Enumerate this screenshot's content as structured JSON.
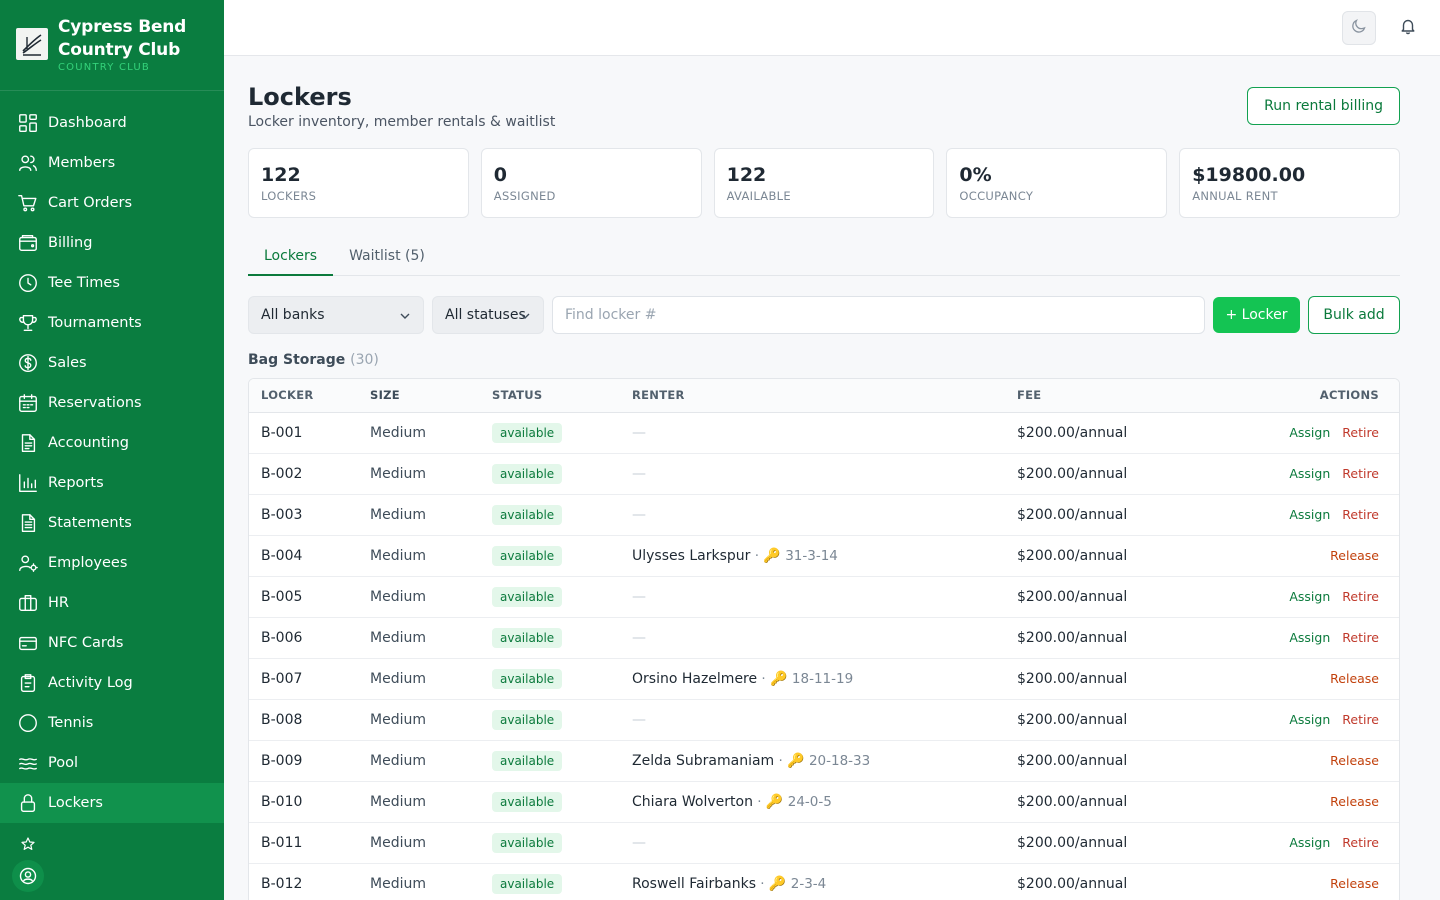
{
  "brand": {
    "name_line1": "Cypress Bend",
    "name_line2": "Country Club",
    "subtitle": "COUNTRY CLUB"
  },
  "sidebar": {
    "items": [
      {
        "label": "Dashboard",
        "icon": "dashboard-icon"
      },
      {
        "label": "Members",
        "icon": "members-icon"
      },
      {
        "label": "Cart Orders",
        "icon": "cart-icon"
      },
      {
        "label": "Billing",
        "icon": "wallet-icon"
      },
      {
        "label": "Tee Times",
        "icon": "clock-icon"
      },
      {
        "label": "Tournaments",
        "icon": "trophy-icon"
      },
      {
        "label": "Sales",
        "icon": "dollar-icon"
      },
      {
        "label": "Reservations",
        "icon": "calendar-icon"
      },
      {
        "label": "Accounting",
        "icon": "document-icon"
      },
      {
        "label": "Reports",
        "icon": "bar-chart-icon"
      },
      {
        "label": "Statements",
        "icon": "statement-icon"
      },
      {
        "label": "Employees",
        "icon": "employee-icon"
      },
      {
        "label": "HR",
        "icon": "briefcase-icon"
      },
      {
        "label": "NFC Cards",
        "icon": "card-icon"
      },
      {
        "label": "Activity Log",
        "icon": "clipboard-icon"
      },
      {
        "label": "Tennis",
        "icon": "tennis-icon"
      },
      {
        "label": "Pool",
        "icon": "waves-icon"
      },
      {
        "label": "Lockers",
        "icon": "lock-icon",
        "active": true
      }
    ]
  },
  "header": {
    "title": "Lockers",
    "subtitle": "Locker inventory, member rentals & waitlist",
    "billing_button": "Run rental billing"
  },
  "stats": [
    {
      "value": "122",
      "label": "LOCKERS"
    },
    {
      "value": "0",
      "label": "ASSIGNED"
    },
    {
      "value": "122",
      "label": "AVAILABLE"
    },
    {
      "value": "0%",
      "label": "OCCUPANCY"
    },
    {
      "value": "$19800.00",
      "label": "ANNUAL RENT"
    }
  ],
  "tabs": [
    {
      "label": "Lockers",
      "active": true
    },
    {
      "label": "Waitlist (5)",
      "active": false
    }
  ],
  "filters": {
    "bank": "All banks",
    "status": "All statuses",
    "search_placeholder": "Find locker #",
    "add_label": "+ Locker",
    "bulk_label": "Bulk add"
  },
  "group": {
    "name": "Bag Storage",
    "count": "(30)"
  },
  "table": {
    "columns": {
      "locker": "LOCKER",
      "size": "SIZE",
      "status": "STATUS",
      "renter": "RENTER",
      "fee": "FEE",
      "actions": "ACTIONS"
    },
    "rows": [
      {
        "locker": "B-001",
        "size": "Medium",
        "status": "available",
        "renter": "",
        "code": "",
        "fee": "$200.00/annual",
        "actions": [
          "Assign",
          "Retire"
        ]
      },
      {
        "locker": "B-002",
        "size": "Medium",
        "status": "available",
        "renter": "",
        "code": "",
        "fee": "$200.00/annual",
        "actions": [
          "Assign",
          "Retire"
        ]
      },
      {
        "locker": "B-003",
        "size": "Medium",
        "status": "available",
        "renter": "",
        "code": "",
        "fee": "$200.00/annual",
        "actions": [
          "Assign",
          "Retire"
        ]
      },
      {
        "locker": "B-004",
        "size": "Medium",
        "status": "available",
        "renter": "Ulysses Larkspur",
        "code": "31-3-14",
        "fee": "$200.00/annual",
        "actions": [
          "Release"
        ]
      },
      {
        "locker": "B-005",
        "size": "Medium",
        "status": "available",
        "renter": "",
        "code": "",
        "fee": "$200.00/annual",
        "actions": [
          "Assign",
          "Retire"
        ]
      },
      {
        "locker": "B-006",
        "size": "Medium",
        "status": "available",
        "renter": "",
        "code": "",
        "fee": "$200.00/annual",
        "actions": [
          "Assign",
          "Retire"
        ]
      },
      {
        "locker": "B-007",
        "size": "Medium",
        "status": "available",
        "renter": "Orsino Hazelmere",
        "code": "18-11-19",
        "fee": "$200.00/annual",
        "actions": [
          "Release"
        ]
      },
      {
        "locker": "B-008",
        "size": "Medium",
        "status": "available",
        "renter": "",
        "code": "",
        "fee": "$200.00/annual",
        "actions": [
          "Assign",
          "Retire"
        ]
      },
      {
        "locker": "B-009",
        "size": "Medium",
        "status": "available",
        "renter": "Zelda Subramaniam",
        "code": "20-18-33",
        "fee": "$200.00/annual",
        "actions": [
          "Release"
        ]
      },
      {
        "locker": "B-010",
        "size": "Medium",
        "status": "available",
        "renter": "Chiara Wolverton",
        "code": "24-0-5",
        "fee": "$200.00/annual",
        "actions": [
          "Release"
        ]
      },
      {
        "locker": "B-011",
        "size": "Medium",
        "status": "available",
        "renter": "",
        "code": "",
        "fee": "$200.00/annual",
        "actions": [
          "Assign",
          "Retire"
        ]
      },
      {
        "locker": "B-012",
        "size": "Medium",
        "status": "available",
        "renter": "Roswell Fairbanks",
        "code": "2-3-4",
        "fee": "$200.00/annual",
        "actions": [
          "Release"
        ]
      }
    ]
  },
  "colors": {
    "sidebar": "#0a7d40",
    "accent": "#14c453",
    "accent_dark": "#0b7a3c",
    "danger": "#c0392b"
  }
}
